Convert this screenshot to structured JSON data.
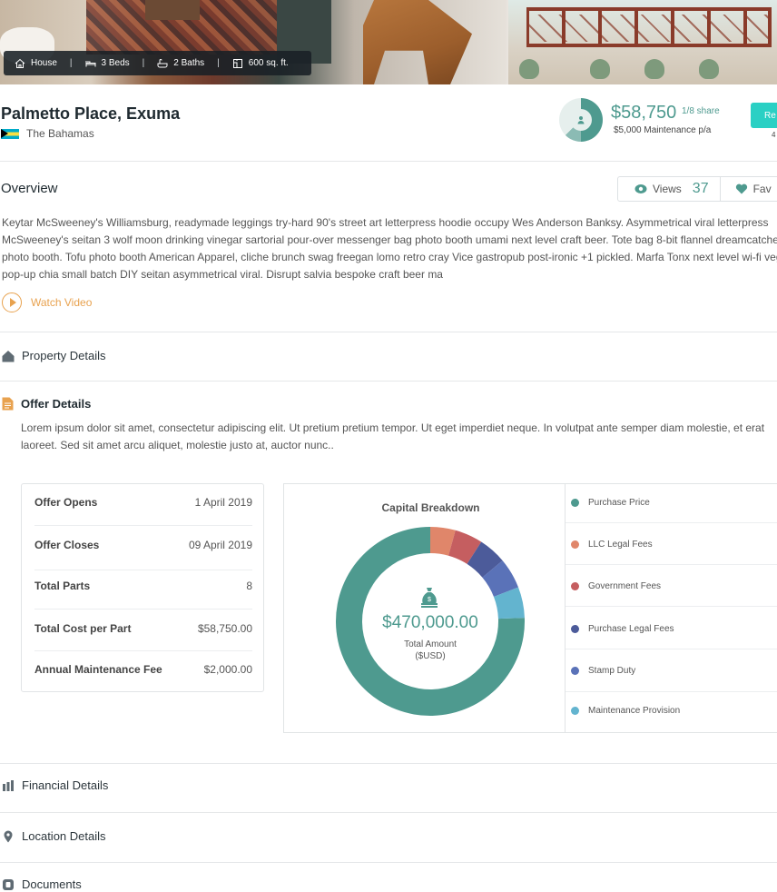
{
  "hero": {
    "features": [
      {
        "icon": "house-icon",
        "label": "House"
      },
      {
        "icon": "bed-icon",
        "label": "3 Beds"
      },
      {
        "icon": "bath-icon",
        "label": "2 Baths"
      },
      {
        "icon": "area-icon",
        "label": "600 sq. ft."
      }
    ]
  },
  "property": {
    "title": "Palmetto Place, Exuma",
    "country": "The Bahamas",
    "price": "$58,750",
    "share": "1/8 share",
    "share_fraction": 0.125,
    "maintenance": "$5,000 Maintenance p/a",
    "reserve_button": "Re",
    "reserve_note": "4"
  },
  "overview": {
    "title": "Overview",
    "views_label": "Views",
    "views_count": "37",
    "favorite_label": "Fav",
    "text": "Keytar McSweeney's Williamsburg, readymade leggings try-hard 90's street art letterpress hoodie occupy Wes Anderson Banksy. Asymmetrical viral letterpress McSweeney's seitan 3 wolf moon drinking vinegar sartorial pour-over messenger bag photo booth umami next level craft beer. Tote bag 8-bit flannel dreamcatcher photo booth. Tofu photo booth American Apparel, cliche brunch swag freegan lomo retro cray Vice gastropub post-ironic +1 pickled. Marfa Tonx next level wi-fi vegan pop-up chia small batch DIY seitan asymmetrical viral. Disrupt salvia bespoke craft beer ma",
    "watch_video": "Watch Video"
  },
  "sections": {
    "property_details": "Property Details",
    "offer_details": "Offer Details",
    "financial_details": "Financial Details",
    "location_details": "Location Details",
    "documents": "Documents"
  },
  "offer": {
    "text": "Lorem ipsum dolor sit amet, consectetur adipiscing elit. Ut pretium pretium tempor. Ut eget imperdiet neque. In volutpat ante semper diam molestie, et erat laoreet. Sed sit amet arcu aliquet, molestie justo at, auctor nunc..",
    "rows": [
      {
        "label": "Offer Opens",
        "value": "1 April 2019"
      },
      {
        "label": "Offer Closes",
        "value": "09 April 2019"
      },
      {
        "label": "Total Parts",
        "value": "8"
      },
      {
        "label": "Total Cost per Part",
        "value": "$58,750.00"
      },
      {
        "label": "Annual Maintenance Fee",
        "value": "$2,000.00"
      }
    ]
  },
  "chart_data": {
    "type": "pie",
    "title": "Capital Breakdown",
    "center_amount": "$470,000.00",
    "center_label_1": "Total Amount",
    "center_label_2": "($USD)",
    "categories": [
      "Purchase Price",
      "LLC Legal Fees",
      "Government Fees",
      "Purchase Legal Fees",
      "Stamp Duty",
      "Maintenance Provision"
    ],
    "values": [
      79,
      4.5,
      5,
      5,
      5.5,
      5.5
    ],
    "colors": [
      "#4e9a8f",
      "#e0866a",
      "#c55e60",
      "#4c5b9a",
      "#5a72b8",
      "#63b4cf"
    ]
  }
}
